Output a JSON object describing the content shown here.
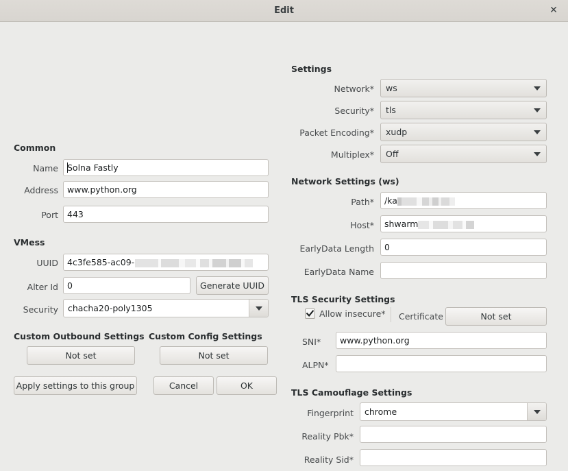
{
  "window": {
    "title": "Edit",
    "close_label": "✕",
    "close_icon": "close-icon"
  },
  "left": {
    "common": {
      "title": "Common",
      "fields": [
        {
          "label": "Name",
          "value": "Solna Fastly",
          "has_caret": true
        },
        {
          "label": "Address",
          "value": "www.python.org",
          "has_caret": false
        },
        {
          "label": "Port",
          "value": "443",
          "has_caret": false
        }
      ]
    },
    "vmess": {
      "title": "VMess",
      "uuid_label": "UUID",
      "uuid_value": "4c3fe585-ac09-",
      "uuid_redacted": true,
      "alterid_label": "Alter Id",
      "alterid_value": "0",
      "generate_uuid_label": "Generate UUID",
      "security_label": "Security",
      "security_value": "chacha20-poly1305"
    },
    "custom_outbound": {
      "title": "Custom Outbound Settings",
      "button_label": "Not set"
    },
    "custom_config": {
      "title": "Custom Config Settings",
      "button_label": "Not set"
    },
    "actions": {
      "apply_label": "Apply settings to this group",
      "cancel_label": "Cancel",
      "ok_label": "OK"
    }
  },
  "right": {
    "settings": {
      "title": "Settings",
      "rows": [
        {
          "label": "Network*",
          "value": "ws"
        },
        {
          "label": "Security*",
          "value": "tls"
        },
        {
          "label": "Packet Encoding*",
          "value": "xudp"
        },
        {
          "label": "Multiplex*",
          "value": "Off"
        }
      ]
    },
    "network_settings": {
      "title": "Network Settings (ws)",
      "path_label": "Path*",
      "path_value": "/ka",
      "path_redacted": true,
      "host_label": "Host*",
      "host_value": "shwarm",
      "host_redacted": true,
      "earlydata_length_label": "EarlyData Length",
      "earlydata_length_value": "0",
      "earlydata_name_label": "EarlyData Name",
      "earlydata_name_value": ""
    },
    "tls_security": {
      "title": "TLS Security Settings",
      "allow_insecure_label": "Allow insecure*",
      "allow_insecure_checked": true,
      "certificate_label": "Certificate",
      "certificate_button_label": "Not set",
      "sni_label": "SNI*",
      "sni_value": "www.python.org",
      "alpn_label": "ALPN*",
      "alpn_value": ""
    },
    "tls_camouflage": {
      "title": "TLS Camouflage Settings",
      "fingerprint_label": "Fingerprint",
      "fingerprint_value": "chrome",
      "reality_pbk_label": "Reality Pbk*",
      "reality_pbk_value": "",
      "reality_sid_label": "Reality Sid*",
      "reality_sid_value": ""
    }
  },
  "colors": {
    "titlebar": "#dcd9d4",
    "background": "#ebebe9",
    "field_bg": "#ffffff",
    "border": "#c3c0bb",
    "text": "#2e3436"
  }
}
